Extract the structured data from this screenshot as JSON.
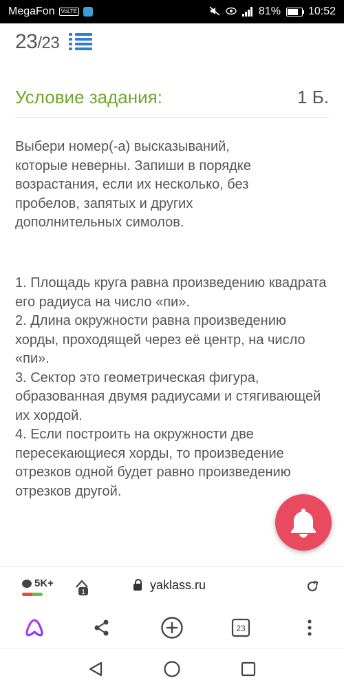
{
  "status_bar": {
    "carrier": "MegaFon",
    "volte": "VoLTE",
    "battery": "81%",
    "time": "10:52"
  },
  "page": {
    "counter_current": "23",
    "counter_total": "/23",
    "condition_title": "Условие задания:",
    "points": "1 Б.",
    "task_text": "Выбери номер(-а) высказываний,\nкоторые неверны. Запиши в порядке\nвозрастания, если их несколько, без\nпробелов, запятых и других\nдополнительных симолов.",
    "statements": [
      "1. Площадь круга равна произведению квадрата его радиуса на число «пи».",
      "2. Длина окружности равна произведению хорды, проходящей через её центр, на число «пи».",
      "3. Сектор это геометрическая фигура, образованная двумя радиусами и стягивающей их хордой.",
      "4. Если построить на окружности две пересекающиеся хорды, то произведение отрезков одной будет равно произведению отрезков другой."
    ]
  },
  "browser": {
    "comments_count": "5K+",
    "tabs_badge": "1",
    "url": "yaklass.ru",
    "tab_count": "23"
  },
  "colors": {
    "accent_green": "#6da62e",
    "accent_blue": "#2f7fd0",
    "bell": "#e84a5f"
  }
}
